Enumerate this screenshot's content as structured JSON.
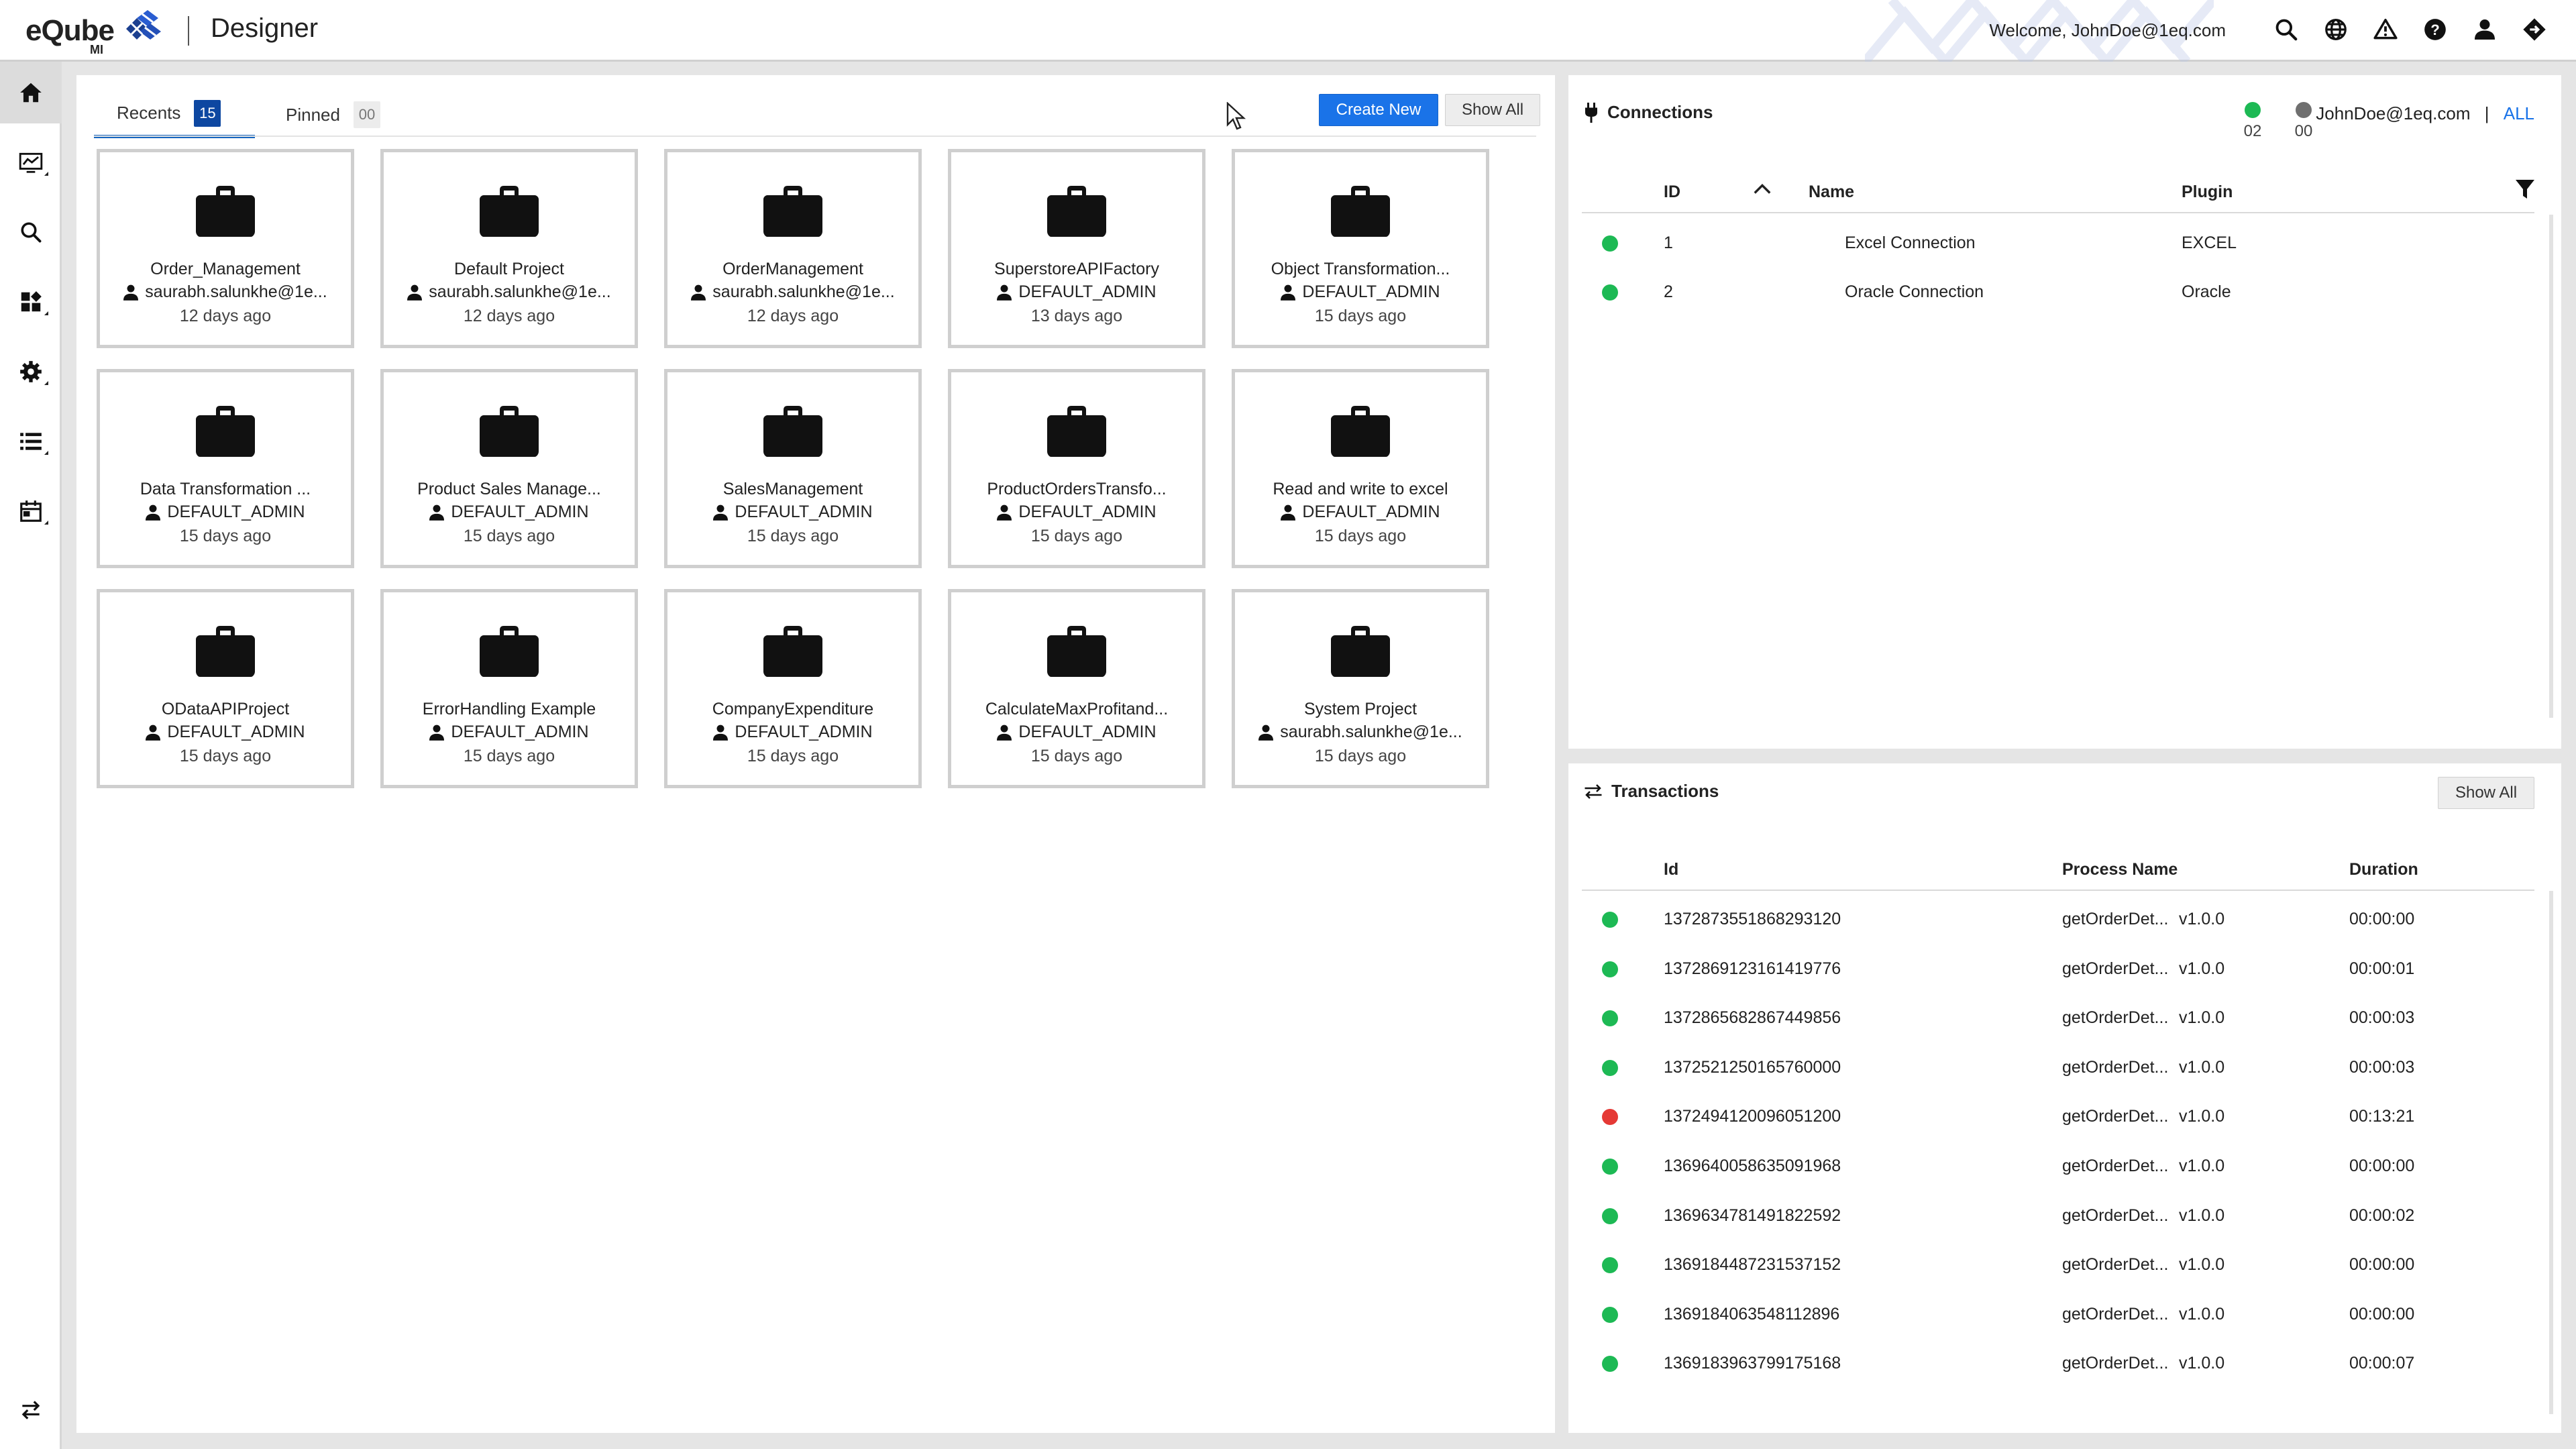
{
  "app": {
    "brand": "eQube",
    "brand_sub": "MI",
    "title": "Designer",
    "welcome": "Welcome, JohnDoe@1eq.com"
  },
  "top_icons": [
    "search-icon",
    "globe-icon",
    "warning-icon",
    "help-icon",
    "user-icon",
    "logout-icon"
  ],
  "sidebar": {
    "items": [
      {
        "icon": "home-icon",
        "active": true
      },
      {
        "icon": "chart-icon"
      },
      {
        "icon": "search-icon"
      },
      {
        "icon": "dashboard-icon"
      },
      {
        "icon": "settings-icon"
      },
      {
        "icon": "list-icon"
      },
      {
        "icon": "calendar-icon"
      }
    ],
    "bottom_icon": "sync-icon"
  },
  "projects": {
    "tabs": [
      {
        "label": "Recents",
        "count": "15",
        "active": true
      },
      {
        "label": "Pinned",
        "count": "00",
        "active": false
      }
    ],
    "create_label": "Create New",
    "show_all_label": "Show All",
    "cards": [
      {
        "name": "Order_Management",
        "owner": "saurabh.salunkhe@1e...",
        "time": "12 days ago"
      },
      {
        "name": "Default Project",
        "owner": "saurabh.salunkhe@1e...",
        "time": "12 days ago"
      },
      {
        "name": "OrderManagement",
        "owner": "saurabh.salunkhe@1e...",
        "time": "12 days ago"
      },
      {
        "name": "SuperstoreAPIFactory",
        "owner": "DEFAULT_ADMIN",
        "time": "13 days ago"
      },
      {
        "name": "Object Transformation...",
        "owner": "DEFAULT_ADMIN",
        "time": "15 days ago"
      },
      {
        "name": "Data Transformation ...",
        "owner": "DEFAULT_ADMIN",
        "time": "15 days ago"
      },
      {
        "name": "Product Sales Manage...",
        "owner": "DEFAULT_ADMIN",
        "time": "15 days ago"
      },
      {
        "name": "SalesManagement",
        "owner": "DEFAULT_ADMIN",
        "time": "15 days ago"
      },
      {
        "name": "ProductOrdersTransfo...",
        "owner": "DEFAULT_ADMIN",
        "time": "15 days ago"
      },
      {
        "name": "Read and write to excel",
        "owner": "DEFAULT_ADMIN",
        "time": "15 days ago"
      },
      {
        "name": "ODataAPIProject",
        "owner": "DEFAULT_ADMIN",
        "time": "15 days ago"
      },
      {
        "name": "ErrorHandling Example",
        "owner": "DEFAULT_ADMIN",
        "time": "15 days ago"
      },
      {
        "name": "CompanyExpenditure",
        "owner": "DEFAULT_ADMIN",
        "time": "15 days ago"
      },
      {
        "name": "CalculateMaxProfitand...",
        "owner": "DEFAULT_ADMIN",
        "time": "15 days ago"
      },
      {
        "name": "System Project",
        "owner": "saurabh.salunkhe@1e...",
        "time": "15 days ago"
      }
    ]
  },
  "connections": {
    "title": "Connections",
    "active_count": "02",
    "inactive_count": "00",
    "user": "JohnDoe@1eq.com",
    "separator": "|",
    "filter_all": "ALL",
    "columns": {
      "id": "ID",
      "name": "Name",
      "plugin": "Plugin"
    },
    "rows": [
      {
        "id": "1",
        "name": "Excel Connection",
        "plugin": "EXCEL",
        "status": "green"
      },
      {
        "id": "2",
        "name": "Oracle Connection",
        "plugin": "Oracle",
        "status": "green"
      }
    ]
  },
  "transactions": {
    "title": "Transactions",
    "show_all_label": "Show All",
    "columns": {
      "id": "Id",
      "process": "Process Name",
      "duration": "Duration"
    },
    "rows": [
      {
        "id": "1372873551868293120",
        "process": "getOrderDet...",
        "version": "v1.0.0",
        "duration": "00:00:00",
        "status": "green"
      },
      {
        "id": "1372869123161419776",
        "process": "getOrderDet...",
        "version": "v1.0.0",
        "duration": "00:00:01",
        "status": "green"
      },
      {
        "id": "1372865682867449856",
        "process": "getOrderDet...",
        "version": "v1.0.0",
        "duration": "00:00:03",
        "status": "green"
      },
      {
        "id": "1372521250165760000",
        "process": "getOrderDet...",
        "version": "v1.0.0",
        "duration": "00:00:03",
        "status": "green"
      },
      {
        "id": "1372494120096051200",
        "process": "getOrderDet...",
        "version": "v1.0.0",
        "duration": "00:13:21",
        "status": "red"
      },
      {
        "id": "1369640058635091968",
        "process": "getOrderDet...",
        "version": "v1.0.0",
        "duration": "00:00:00",
        "status": "green"
      },
      {
        "id": "1369634781491822592",
        "process": "getOrderDet...",
        "version": "v1.0.0",
        "duration": "00:00:02",
        "status": "green"
      },
      {
        "id": "1369184487231537152",
        "process": "getOrderDet...",
        "version": "v1.0.0",
        "duration": "00:00:00",
        "status": "green"
      },
      {
        "id": "1369184063548112896",
        "process": "getOrderDet...",
        "version": "v1.0.0",
        "duration": "00:00:00",
        "status": "green"
      },
      {
        "id": "1369183963799175168",
        "process": "getOrderDet...",
        "version": "v1.0.0",
        "duration": "00:00:07",
        "status": "green"
      }
    ]
  },
  "colors": {
    "accent": "#1a73e8",
    "tab_badge": "#0d47a1",
    "status_green": "#1db954",
    "status_red": "#e53935",
    "status_grey": "#6f6f6f"
  }
}
